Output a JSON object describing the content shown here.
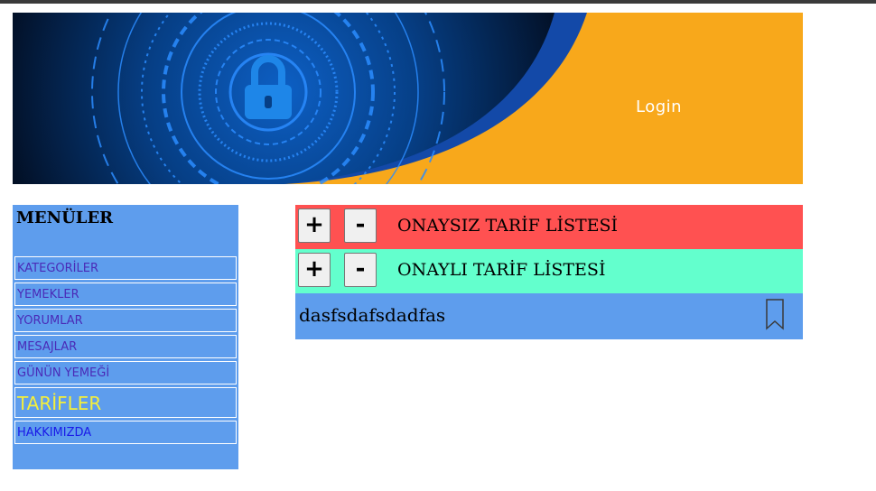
{
  "banner": {
    "login_label": "Login"
  },
  "menu": {
    "title": "MENÜLER",
    "items": [
      {
        "label": "KATEGORİLER"
      },
      {
        "label": "YEMEKLER"
      },
      {
        "label": "YORUMLAR"
      },
      {
        "label": "MESAJLAR"
      },
      {
        "label": "GÜNÜN YEMEĞİ"
      },
      {
        "label": "TARİFLER"
      },
      {
        "label": "HAKKIMIZDA"
      }
    ]
  },
  "lists": {
    "unapproved": {
      "plus": "+",
      "minus": "-",
      "label": "ONAYSIZ TARİF LİSTESİ"
    },
    "approved": {
      "plus": "+",
      "minus": "-",
      "label": "ONAYLI TARİF LİSTESİ"
    }
  },
  "recipe": {
    "text": "dasfsdafsdadfas",
    "icon": "bookmark-icon"
  },
  "colors": {
    "banner_orange": "#f8a81b",
    "menu_blue": "#5e9ded",
    "unapproved_red": "#ff5151",
    "approved_green": "#63ffcd",
    "active_yellow": "#f5ef3a"
  }
}
